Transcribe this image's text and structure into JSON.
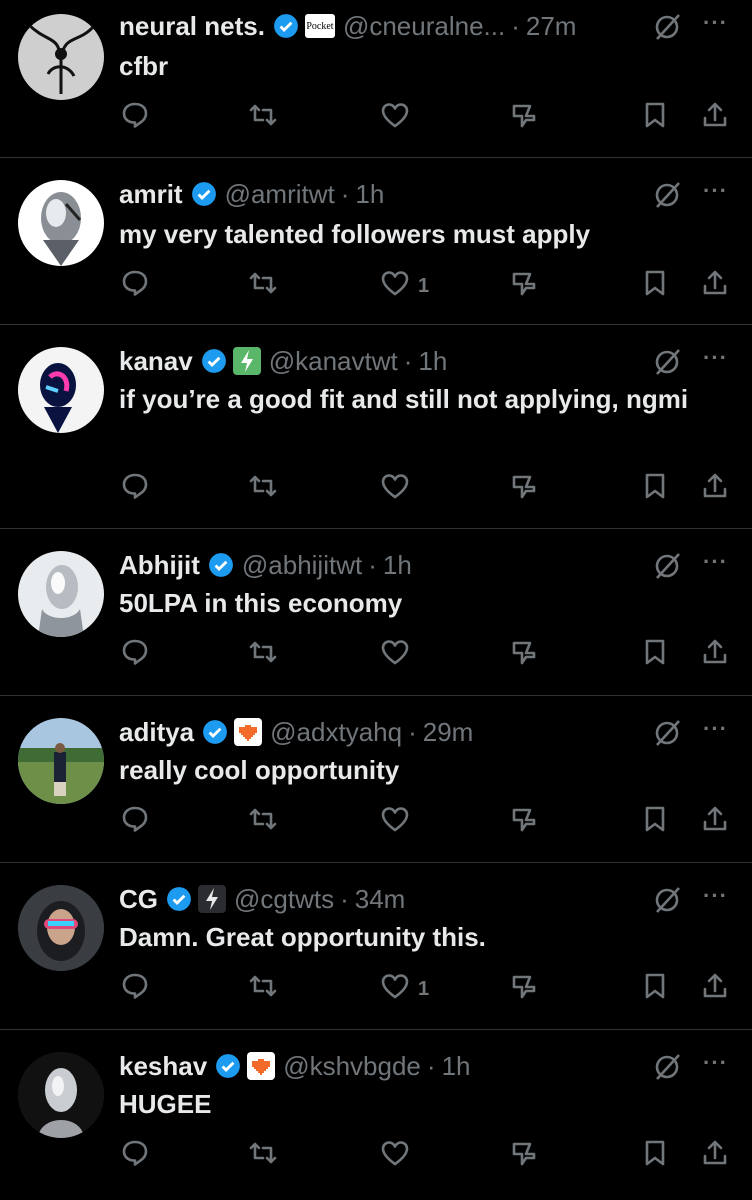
{
  "posts": [
    {
      "name": "neural nets.",
      "badge": "Pocket",
      "handle": "@cneuralne...",
      "time": "27m",
      "text": "cfbr",
      "like_count": ""
    },
    {
      "name": "amrit",
      "badge": "",
      "handle": "@amritwt",
      "time": "1h",
      "text": "my very talented followers must apply",
      "like_count": "1"
    },
    {
      "name": "kanav",
      "badge": "bolt-green",
      "handle": "@kanavtwt",
      "time": "1h",
      "text": "if you’re a good fit and still not applying, ngmi",
      "like_count": ""
    },
    {
      "name": "Abhijit",
      "badge": "",
      "handle": "@abhijitwt",
      "time": "1h",
      "text": "50LPA in this economy",
      "like_count": ""
    },
    {
      "name": "aditya",
      "badge": "pixel-heart",
      "handle": "@adxtyahq",
      "time": "29m",
      "text": "really cool opportunity",
      "like_count": ""
    },
    {
      "name": "CG",
      "badge": "bolt-dark",
      "handle": "@cgtwts",
      "time": "34m",
      "text": "Damn. Great opportunity this.",
      "like_count": "1"
    },
    {
      "name": "keshav",
      "badge": "pixel-heart",
      "handle": "@kshvbgde",
      "time": "1h",
      "text": "HUGEE",
      "like_count": ""
    }
  ],
  "separator": "·",
  "more": "···",
  "colors": {
    "background": "#000000",
    "text": "#e7e9ea",
    "muted": "#71767b",
    "verified": "#1d9bf0",
    "divider": "#2f3336"
  }
}
